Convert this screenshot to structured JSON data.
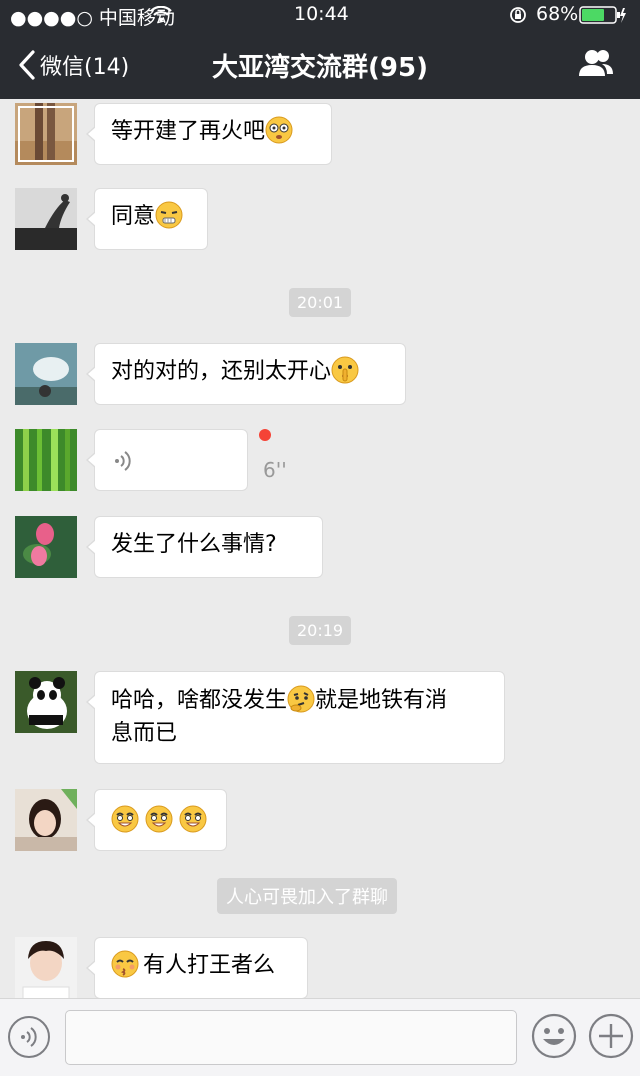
{
  "status_bar": {
    "carrier": "●●●●○ 中国移动",
    "time": "10:44",
    "battery": "68%"
  },
  "nav": {
    "back_label": "微信(14)",
    "title": "大亚湾交流群(95)"
  },
  "messages": [
    {
      "text": "等开建了再火吧",
      "emoji": "dizzy-face"
    },
    {
      "text": "同意",
      "emoji": "zipper-face"
    },
    {
      "time": "20:01"
    },
    {
      "text": "对的对的，还别太开心",
      "emoji": "shush-face"
    },
    {
      "voice_duration": "6''",
      "unread": true
    },
    {
      "text": "发生了什么事情?"
    },
    {
      "time": "20:19"
    },
    {
      "text_line1": "哈哈，啥都没发生",
      "text_line1b": "就是地铁有消",
      "text_line2": "息而已",
      "emoji": "thinking-face"
    },
    {
      "emoji_count": 3,
      "emoji": "grin-face"
    },
    {
      "system": "人心可畏加入了群聊"
    },
    {
      "text": "有人打王者么",
      "emoji": "kiss-face"
    }
  ],
  "colors": {
    "nav_bg": "#292c31",
    "chat_bg": "#ebebeb",
    "bubble_bg": "#ffffff",
    "battery_fill": "#4cd964",
    "unread_dot": "#f54336"
  },
  "icons": [
    "chevron-left-icon",
    "contacts-icon",
    "voice-icon",
    "emoji-face-icon",
    "plus-icon"
  ]
}
